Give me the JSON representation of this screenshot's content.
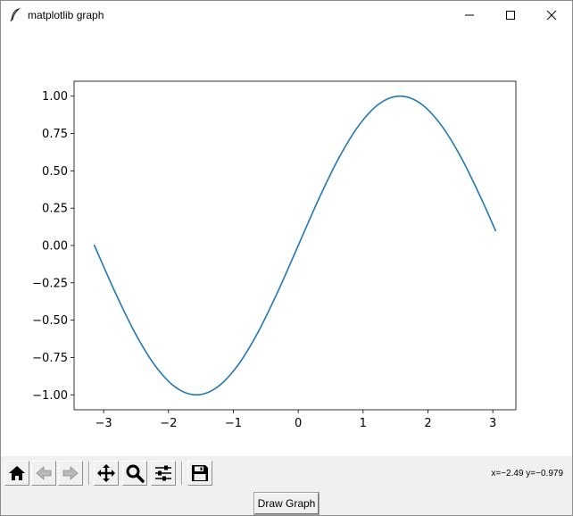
{
  "window": {
    "title": "matplotlib graph",
    "controls": [
      "minimize-icon",
      "maximize-icon",
      "close-icon"
    ]
  },
  "chart_data": {
    "type": "line",
    "title": "",
    "xlabel": "",
    "ylabel": "",
    "function": "sin(x)",
    "x": [
      -3.1416,
      -2.8274,
      -2.5133,
      -2.1991,
      -1.885,
      -1.5708,
      -1.2566,
      -0.9425,
      -0.6283,
      -0.3142,
      0.0,
      0.3142,
      0.6283,
      0.9425,
      1.2566,
      1.5708,
      1.885,
      2.1991,
      2.5133,
      2.8274,
      3.0416
    ],
    "series": [
      {
        "color": "#1f77b4",
        "values": [
          0.0,
          -0.309,
          -0.5878,
          -0.809,
          -0.9511,
          -1.0,
          -0.9511,
          -0.809,
          -0.5878,
          -0.309,
          0.0,
          0.309,
          0.5878,
          0.809,
          0.9511,
          1.0,
          0.9511,
          0.809,
          0.5878,
          0.309,
          0.0998
        ]
      }
    ],
    "xlim": [
      -3.4558,
      3.3558
    ],
    "ylim": [
      -1.1,
      1.1
    ],
    "xticks": [
      -3,
      -2,
      -1,
      0,
      1,
      2,
      3
    ],
    "xtick_labels": [
      "−3",
      "−2",
      "−1",
      "0",
      "1",
      "2",
      "3"
    ],
    "yticks": [
      1.0,
      0.75,
      0.5,
      0.25,
      0.0,
      -0.25,
      -0.5,
      -0.75,
      -1.0
    ],
    "ytick_labels": [
      "1.00",
      "0.75",
      "0.50",
      "0.25",
      "0.00",
      "−0.25",
      "−0.50",
      "−0.75",
      "−1.00"
    ],
    "grid": false,
    "legend": "none"
  },
  "toolbar": {
    "buttons": [
      {
        "name": "home-button",
        "icon": "home-icon"
      },
      {
        "name": "back-button",
        "icon": "back-arrow-icon"
      },
      {
        "name": "forward-button",
        "icon": "forward-arrow-icon"
      },
      {
        "name": "pan-button",
        "icon": "move-arrows-icon"
      },
      {
        "name": "zoom-button",
        "icon": "magnifier-icon"
      },
      {
        "name": "subplots-button",
        "icon": "sliders-icon"
      },
      {
        "name": "save-button",
        "icon": "floppy-disk-icon"
      }
    ],
    "coords_text": "x=−2.49 y=−0.979"
  },
  "bottom": {
    "draw_button_label": "Draw Graph"
  }
}
